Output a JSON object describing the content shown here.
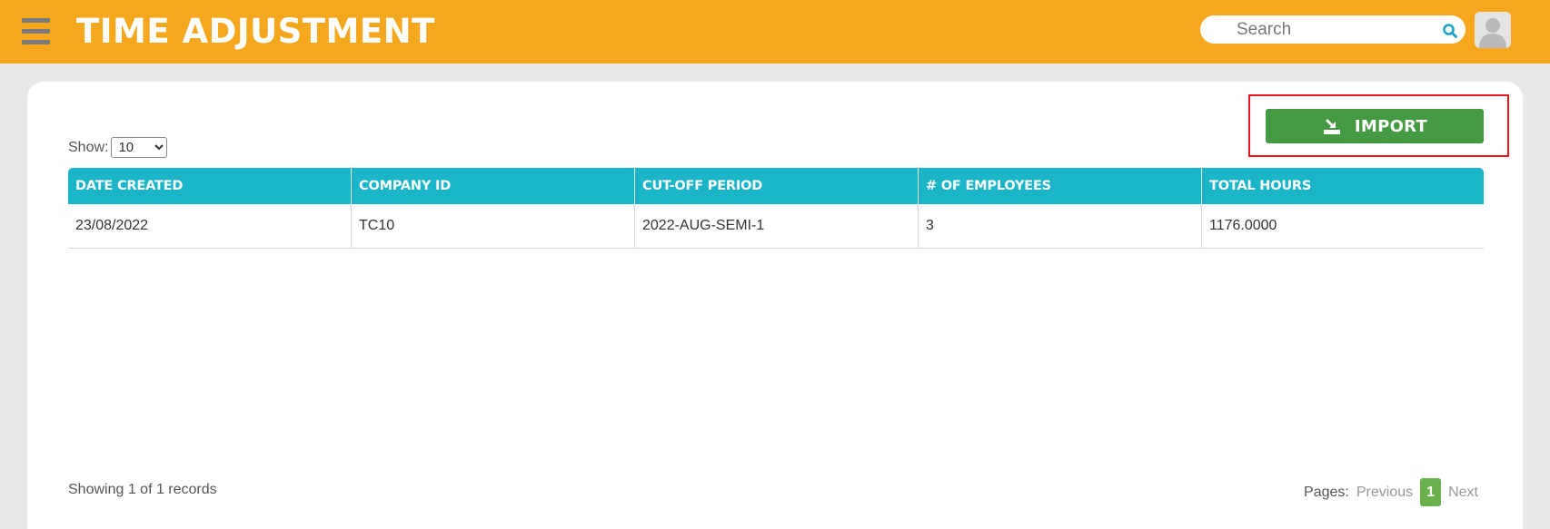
{
  "header": {
    "title": "TIME ADJUSTMENT",
    "search_placeholder": "Search"
  },
  "controls": {
    "show_label": "Show:",
    "page_size": "10",
    "page_size_options": [
      "10"
    ],
    "import_label": "IMPORT"
  },
  "table": {
    "columns": [
      "DATE CREATED",
      "COMPANY ID",
      "CUT-OFF PERIOD",
      "# OF EMPLOYEES",
      "TOTAL HOURS"
    ],
    "rows": [
      [
        "23/08/2022",
        "TC10",
        "2022-AUG-SEMI-1",
        "3",
        "1176.0000"
      ]
    ]
  },
  "footer": {
    "records_text": "Showing 1 of 1 records",
    "pages_label": "Pages:",
    "previous_label": "Previous",
    "current_page": "1",
    "next_label": "Next"
  },
  "colors": {
    "header_bg": "#f5a81e",
    "table_header_bg": "#1bb5ca",
    "import_button": "#449a42",
    "highlight_border": "#e8141a",
    "current_page_bg": "#6ab04c"
  },
  "icons": [
    "menu-icon",
    "search-icon",
    "avatar-icon",
    "import-icon"
  ]
}
